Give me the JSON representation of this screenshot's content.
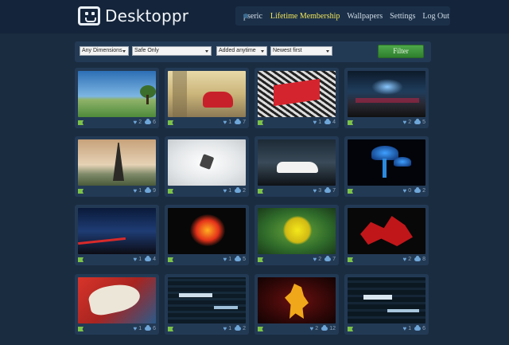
{
  "brand": {
    "name": "Desktoppr"
  },
  "nav": {
    "user": "pseric",
    "items": [
      {
        "label": "Lifetime Membership"
      },
      {
        "label": "Wallpapers"
      },
      {
        "label": "Settings"
      },
      {
        "label": "Log Out"
      }
    ]
  },
  "filters": {
    "dimensions": "Any Dimensions",
    "safety": "Safe Only",
    "added": "Added anytime",
    "sort": "Newest first",
    "button": "Filter"
  },
  "wallpapers": [
    {
      "subject": "tree-on-hill",
      "likes": "2",
      "downloads": "6"
    },
    {
      "subject": "red-beetle-car",
      "likes": "1",
      "downloads": "7"
    },
    {
      "subject": "2013-text-art",
      "likes": "1",
      "downloads": "4"
    },
    {
      "subject": "neon-city-street",
      "likes": "2",
      "downloads": "5"
    },
    {
      "subject": "eiffel-tower",
      "likes": "1",
      "downloads": "9"
    },
    {
      "subject": "abstract-white",
      "likes": "1",
      "downloads": "2"
    },
    {
      "subject": "white-lamborghini",
      "likes": "3",
      "downloads": "7"
    },
    {
      "subject": "blue-mushrooms",
      "likes": "0",
      "downloads": "2"
    },
    {
      "subject": "night-road",
      "likes": "1",
      "downloads": "4"
    },
    {
      "subject": "red-flower",
      "likes": "1",
      "downloads": "5"
    },
    {
      "subject": "yellow-rose-emblem",
      "likes": "2",
      "downloads": "7"
    },
    {
      "subject": "red-dragon",
      "likes": "2",
      "downloads": "8"
    },
    {
      "subject": "koi-fish",
      "likes": "1",
      "downloads": "6"
    },
    {
      "subject": "typography-dark",
      "likes": "1",
      "downloads": "2"
    },
    {
      "subject": "lion-emblem",
      "likes": "2",
      "downloads": "12"
    },
    {
      "subject": "typography-quote",
      "likes": "1",
      "downloads": "6"
    }
  ],
  "colors": {
    "accent": "#f1e45a",
    "filter_button": "#3e9a3b",
    "background": "#1a2c40"
  }
}
